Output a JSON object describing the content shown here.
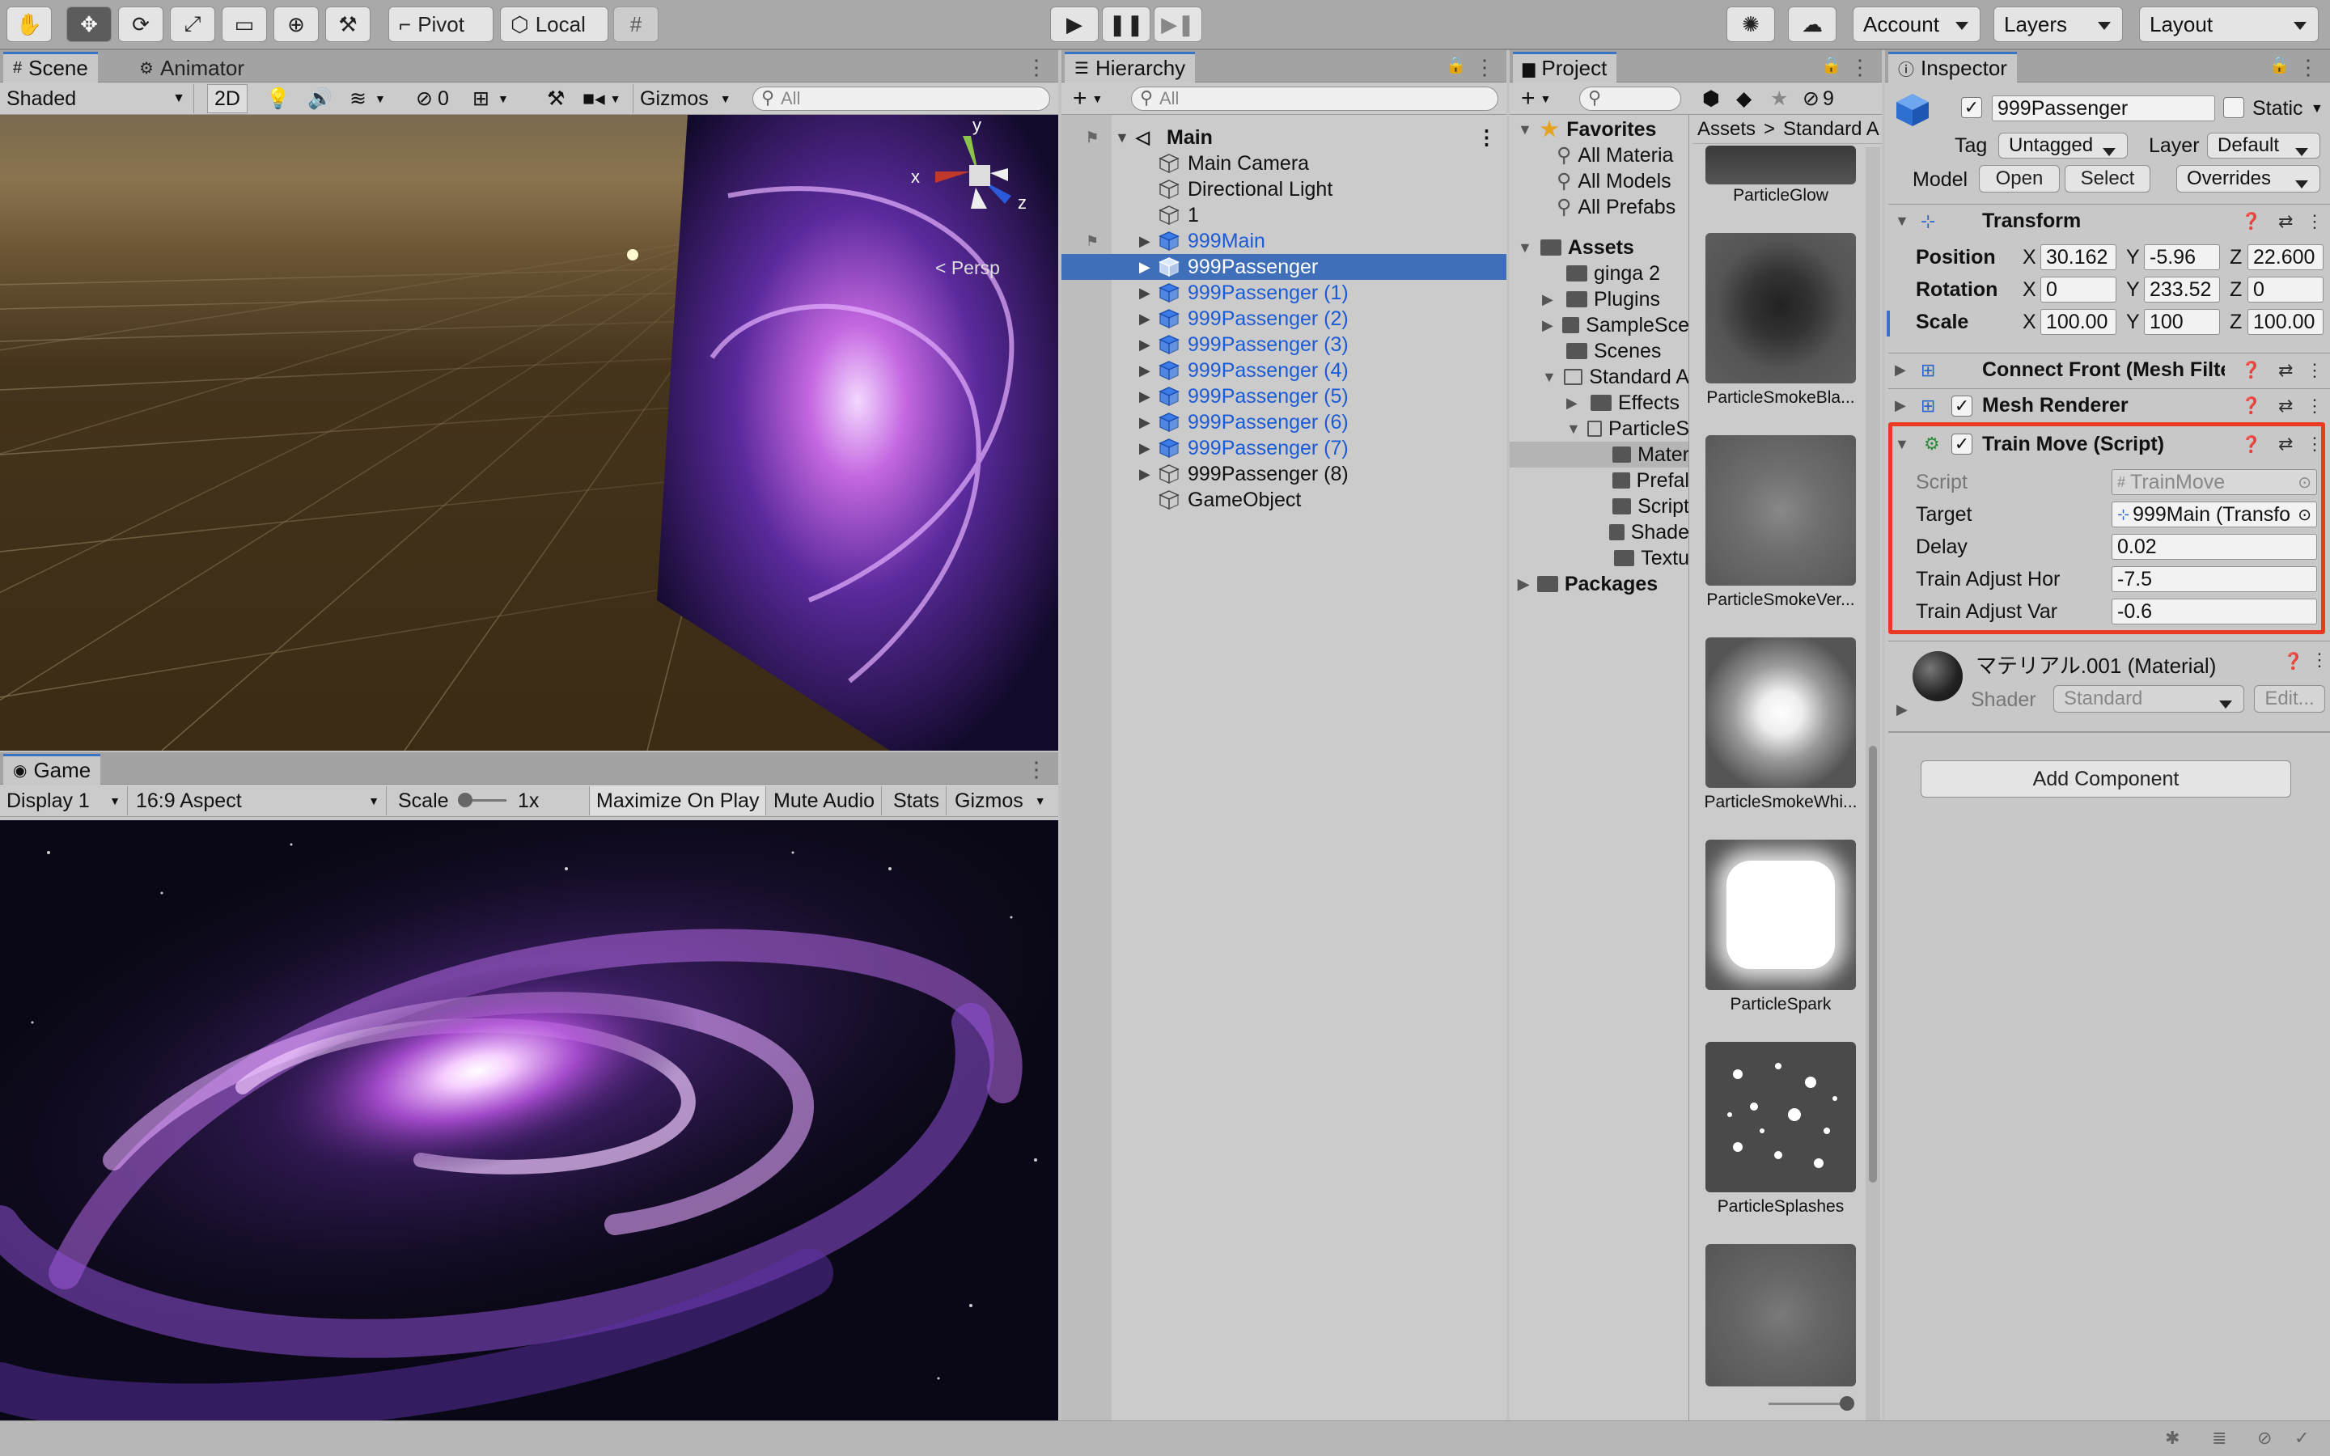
{
  "toolbar": {
    "pivot": "Pivot",
    "local": "Local",
    "account": "Account",
    "layers": "Layers",
    "layout": "Layout"
  },
  "scene": {
    "tab_scene": "Scene",
    "tab_animator": "Animator",
    "shading": "Shaded",
    "mode_2d": "2D",
    "hidden_count": "0",
    "gizmos": "Gizmos",
    "search_placeholder": "All",
    "persp_label": "< Persp",
    "axis_x": "x",
    "axis_y": "y",
    "axis_z": "z"
  },
  "game": {
    "tab": "Game",
    "display": "Display 1",
    "aspect": "16:9 Aspect",
    "scale_label": "Scale",
    "scale_value": "1x",
    "maximize": "Maximize On Play",
    "mute": "Mute Audio",
    "stats": "Stats",
    "gizmos": "Gizmos"
  },
  "hierarchy": {
    "tab": "Hierarchy",
    "search_placeholder": "All",
    "root": "Main",
    "items": [
      {
        "label": "Main Camera",
        "prefab": false,
        "expandable": false
      },
      {
        "label": "Directional Light",
        "prefab": false,
        "expandable": false
      },
      {
        "label": "1",
        "prefab": false,
        "expandable": false
      },
      {
        "label": "999Main",
        "prefab": true,
        "expandable": true
      },
      {
        "label": "999Passenger",
        "prefab": true,
        "expandable": true,
        "selected": true
      },
      {
        "label": "999Passenger (1)",
        "prefab": true,
        "expandable": true
      },
      {
        "label": "999Passenger (2)",
        "prefab": true,
        "expandable": true
      },
      {
        "label": "999Passenger (3)",
        "prefab": true,
        "expandable": true
      },
      {
        "label": "999Passenger (4)",
        "prefab": true,
        "expandable": true
      },
      {
        "label": "999Passenger (5)",
        "prefab": true,
        "expandable": true
      },
      {
        "label": "999Passenger (6)",
        "prefab": true,
        "expandable": true
      },
      {
        "label": "999Passenger (7)",
        "prefab": true,
        "expandable": true
      },
      {
        "label": "999Passenger (8)",
        "prefab": false,
        "expandable": true
      },
      {
        "label": "GameObject",
        "prefab": false,
        "expandable": false
      }
    ]
  },
  "project": {
    "tab": "Project",
    "hidden_count": "9",
    "favorites": "Favorites",
    "fav_items": [
      "All Materia",
      "All Models",
      "All Prefabs"
    ],
    "assets": "Assets",
    "tree": [
      {
        "label": "ginga 2",
        "level": 1,
        "arrow": false
      },
      {
        "label": "Plugins",
        "level": 1,
        "arrow": true
      },
      {
        "label": "SampleSce",
        "level": 1,
        "arrow": true
      },
      {
        "label": "Scenes",
        "level": 1,
        "arrow": false
      },
      {
        "label": "Standard A",
        "level": 1,
        "arrow": true,
        "open": true
      },
      {
        "label": "Effects",
        "level": 2,
        "arrow": true
      },
      {
        "label": "ParticleS",
        "level": 2,
        "arrow": true,
        "open": true
      },
      {
        "label": "Mater",
        "level": 3,
        "arrow": false,
        "selected": true
      },
      {
        "label": "Prefal",
        "level": 3,
        "arrow": false
      },
      {
        "label": "Script",
        "level": 3,
        "arrow": false
      },
      {
        "label": "Shade",
        "level": 3,
        "arrow": false
      },
      {
        "label": "Textu",
        "level": 3,
        "arrow": false
      }
    ],
    "packages": "Packages",
    "breadcrumb_root": "Assets",
    "breadcrumb_child": "Standard A",
    "thumbs": [
      {
        "label": "ParticleGlow"
      },
      {
        "label": "ParticleSmokeBla..."
      },
      {
        "label": "ParticleSmokeVer..."
      },
      {
        "label": "ParticleSmokeWhi..."
      },
      {
        "label": "ParticleSpark"
      },
      {
        "label": "ParticleSplashes"
      }
    ]
  },
  "inspector": {
    "tab": "Inspector",
    "object_name": "999Passenger",
    "static_label": "Static",
    "tag_label": "Tag",
    "tag_value": "Untagged",
    "layer_label": "Layer",
    "layer_value": "Default",
    "model_label": "Model",
    "open": "Open",
    "select": "Select",
    "overrides": "Overrides",
    "transform": {
      "title": "Transform",
      "position_label": "Position",
      "rotation_label": "Rotation",
      "scale_label": "Scale",
      "x": "X",
      "y": "Y",
      "z": "Z",
      "position": [
        "30.162",
        "-5.96",
        "22.600"
      ],
      "rotation": [
        "0",
        "233.52",
        "0"
      ],
      "scale": [
        "100.00",
        "100",
        "100.00"
      ]
    },
    "mesh_filter": "Connect Front (Mesh Filte",
    "mesh_renderer": "Mesh Renderer",
    "train_move": {
      "title": "Train Move (Script)",
      "script_label": "Script",
      "script_value": "TrainMove",
      "target_label": "Target",
      "target_value": "999Main (Transfo",
      "delay_label": "Delay",
      "delay_value": "0.02",
      "hor_label": "Train Adjust Hor",
      "hor_value": "-7.5",
      "var_label": "Train Adjust Var",
      "var_value": "-0.6"
    },
    "material": {
      "name": "マテリアル.001 (Material)",
      "shader_label": "Shader",
      "shader_value": "Standard",
      "edit": "Edit..."
    },
    "add_component": "Add Component"
  },
  "colors": {
    "selection": "#3e6fb8",
    "highlight": "#ea3a24",
    "prefab_text": "#1c5bd6"
  }
}
